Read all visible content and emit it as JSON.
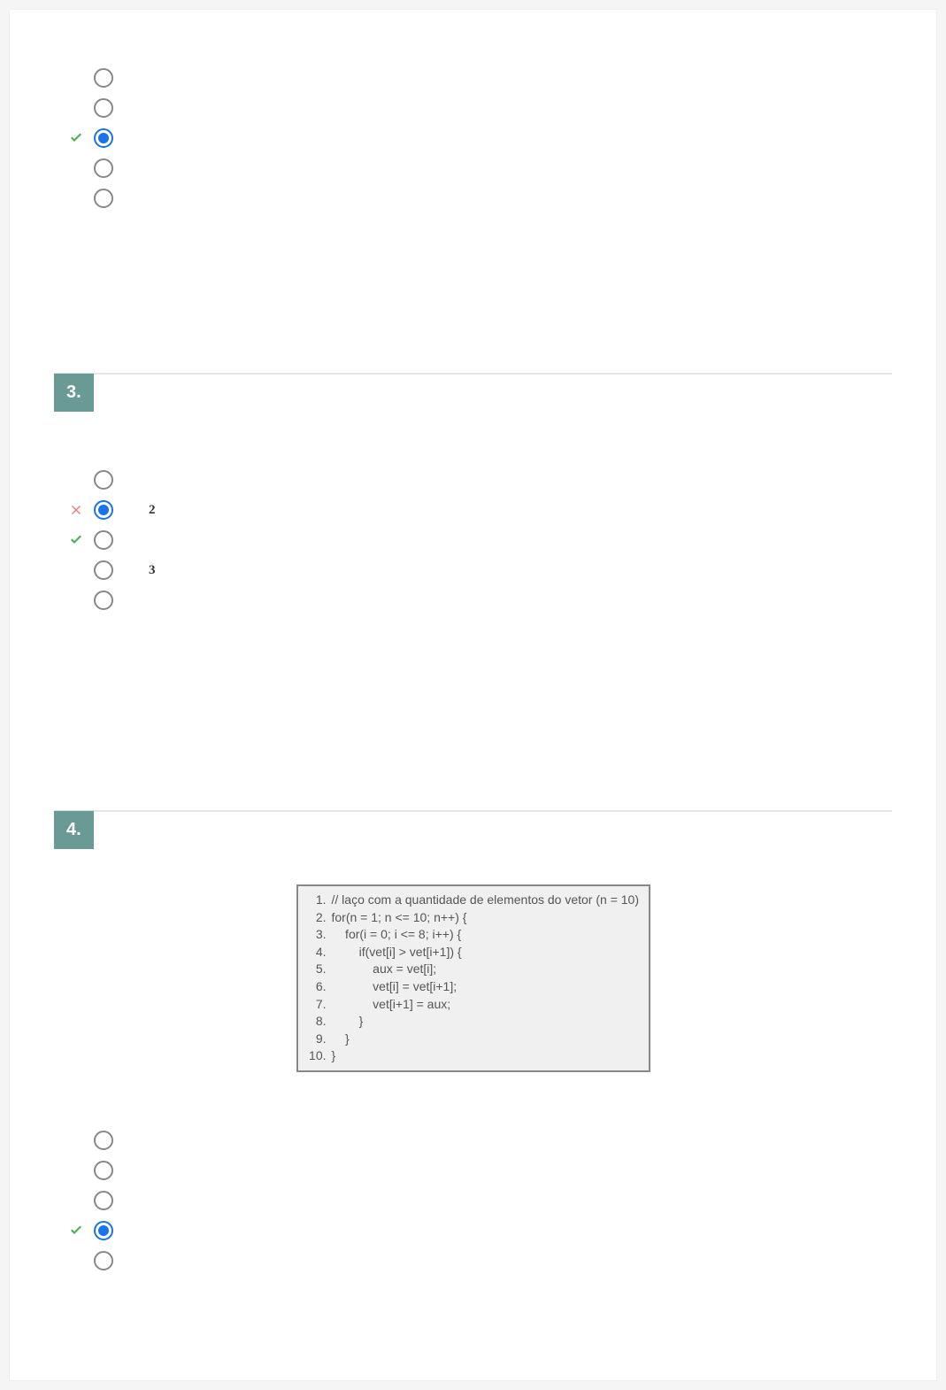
{
  "questions": [
    {
      "number": "",
      "options": [
        {
          "mark": "",
          "selected": false,
          "label": ""
        },
        {
          "mark": "",
          "selected": false,
          "label": ""
        },
        {
          "mark": "check",
          "selected": true,
          "label": ""
        },
        {
          "mark": "",
          "selected": false,
          "label": ""
        },
        {
          "mark": "",
          "selected": false,
          "label": ""
        }
      ]
    },
    {
      "number": "3.",
      "options": [
        {
          "mark": "",
          "selected": false,
          "label": ""
        },
        {
          "mark": "cross",
          "selected": true,
          "label": "2"
        },
        {
          "mark": "check",
          "selected": false,
          "label": ""
        },
        {
          "mark": "",
          "selected": false,
          "label": "3"
        },
        {
          "mark": "",
          "selected": false,
          "label": ""
        }
      ]
    },
    {
      "number": "4.",
      "code": [
        {
          "n": "1.",
          "t": "// laço com a quantidade de elementos do vetor (n = 10)"
        },
        {
          "n": "2.",
          "t": "for(n = 1; n <= 10; n++) {"
        },
        {
          "n": "3.",
          "t": "    for(i = 0; i <= 8; i++) {"
        },
        {
          "n": "4.",
          "t": "        if(vet[i] > vet[i+1]) {"
        },
        {
          "n": "5.",
          "t": "            aux = vet[i];"
        },
        {
          "n": "6.",
          "t": "            vet[i] = vet[i+1];"
        },
        {
          "n": "7.",
          "t": "            vet[i+1] = aux;"
        },
        {
          "n": "8.",
          "t": "        }"
        },
        {
          "n": "9.",
          "t": "    }"
        },
        {
          "n": "10.",
          "t": "}"
        }
      ],
      "options": [
        {
          "mark": "",
          "selected": false,
          "label": ""
        },
        {
          "mark": "",
          "selected": false,
          "label": ""
        },
        {
          "mark": "",
          "selected": false,
          "label": ""
        },
        {
          "mark": "check",
          "selected": true,
          "label": ""
        },
        {
          "mark": "",
          "selected": false,
          "label": ""
        }
      ]
    }
  ]
}
